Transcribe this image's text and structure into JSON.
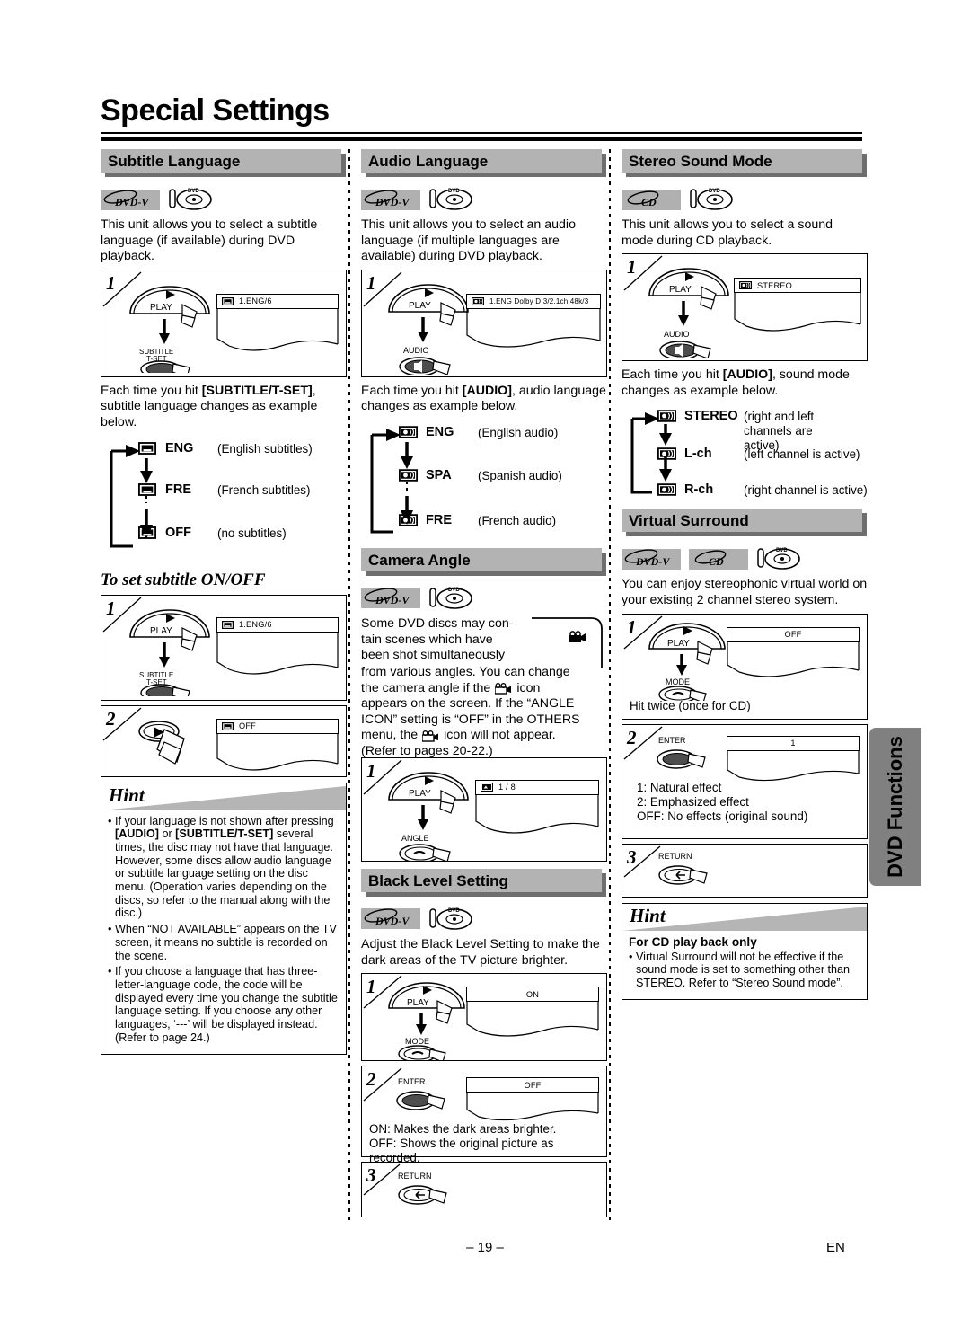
{
  "document": {
    "title": "Special Settings",
    "page_number": "– 19 –",
    "language_code": "EN",
    "side_tab": "DVD Functions"
  },
  "columns": {
    "left": {
      "subtitle_language": {
        "heading": "Subtitle Language",
        "badges": [
          "DVD-V",
          "disc-icon"
        ],
        "intro": "This unit allows you to select a subtitle language (if available) during DVD playback.",
        "step1": {
          "number": "1",
          "button_top": "PLAY",
          "button_bottom_line1": "SUBTITLE",
          "button_bottom_line2": "T-SET",
          "osd": "1.ENG/6",
          "osd_icon": "subtitle-icon"
        },
        "instruction_pre": "Each time you hit ",
        "instruction_key": "[SUBTITLE/T-SET]",
        "instruction_post": ", subtitle language changes as example below.",
        "cycle": [
          {
            "icon": "subtitle-icon",
            "code": "ENG",
            "desc": "(English subtitles)"
          },
          {
            "icon": "subtitle-icon",
            "code": "FRE",
            "desc": "(French subtitles)"
          },
          {
            "icon": "subtitle-icon",
            "code": "OFF",
            "desc": "(no subtitles)"
          }
        ],
        "onoff_heading": "To set subtitle ON/OFF",
        "onoff_step1": {
          "number": "1",
          "button_top": "PLAY",
          "button_bottom_line1": "SUBTITLE",
          "button_bottom_line2": "T-SET",
          "osd": "1.ENG/6"
        },
        "onoff_step2": {
          "number": "2",
          "osd": "OFF"
        }
      },
      "hint": {
        "title": "Hint",
        "items": [
          {
            "parts": [
              {
                "t": "If your language is not shown after pressing ",
                "b": false
              },
              {
                "t": "[AUDIO]",
                "b": true
              },
              {
                "t": " or ",
                "b": false
              },
              {
                "t": "[SUBTITLE/T-SET]",
                "b": true
              },
              {
                "t": " several times, the disc may not have that language. However, some discs allow audio language or subtitle language setting on the disc menu. (Operation varies depending on the discs, so refer to the manual along with the disc.)",
                "b": false
              }
            ]
          },
          {
            "parts": [
              {
                "t": "When “NOT AVAILABLE” appears on the TV screen, it means no subtitle is recorded on the scene.",
                "b": false
              }
            ]
          },
          {
            "parts": [
              {
                "t": "If you choose a language that has three-letter-language code, the code will be displayed every time you change the subtitle language setting. If you choose any other languages, ‘---’ will be displayed instead. (Refer to page 24.)",
                "b": false
              }
            ]
          }
        ]
      }
    },
    "middle": {
      "audio_language": {
        "heading": "Audio Language",
        "badges": [
          "DVD-V",
          "disc-icon"
        ],
        "intro": "This unit allows you to select an audio language (if multiple languages are available) during DVD playback.",
        "step1": {
          "number": "1",
          "button_top": "PLAY",
          "button_bottom_line1": "AUDIO",
          "osd": "1.ENG  Dolby D  3/2.1ch  48k/3",
          "osd_icon": "audio-icon"
        },
        "instruction_pre": "Each time you hit ",
        "instruction_key": "[AUDIO]",
        "instruction_post": ", audio language changes as example below.",
        "cycle": [
          {
            "icon": "audio-icon",
            "code": "ENG",
            "desc": "(English audio)"
          },
          {
            "icon": "audio-icon",
            "code": "SPA",
            "desc": "(Spanish audio)"
          },
          {
            "icon": "audio-icon",
            "code": "FRE",
            "desc": "(French audio)"
          }
        ]
      },
      "camera_angle": {
        "heading": "Camera Angle",
        "badges": [
          "DVD-V",
          "disc-icon"
        ],
        "body": "Some DVD discs may contain scenes which have been shot simultaneously from various angles. You can change the camera angle if the ▒ icon appears on the screen. If the “ANGLE ICON” setting is “OFF” in the OTHERS menu, the ▒ icon will not appear. (Refer to pages 20-22.)",
        "body_line1": "Some DVD discs may con-",
        "body_line2": "tain scenes which have",
        "body_line3": "been shot simultaneously",
        "body_line4": "from various angles. You can change",
        "body_line5a": "the camera angle if the",
        "body_line5b": "icon",
        "body_line6": "appears on the screen. If the “ANGLE",
        "body_line7": "ICON” setting is “OFF” in the OTHERS",
        "body_line8a": "menu, the",
        "body_line8b": "icon will not appear.",
        "body_line9": "(Refer to pages 20-22.)",
        "step1": {
          "number": "1",
          "button_top": "PLAY",
          "button_bottom_line1": "ANGLE",
          "osd": "1 / 8",
          "osd_icon": "angle-icon"
        }
      },
      "black_level": {
        "heading": "Black Level Setting",
        "badges": [
          "DVD-V",
          "disc-icon"
        ],
        "intro": "Adjust the Black Level Setting to make the dark areas of the TV picture brighter.",
        "step1": {
          "number": "1",
          "button_top": "PLAY",
          "button_bottom_line1": "MODE",
          "osd": "ON"
        },
        "step2": {
          "number": "2",
          "button_bottom_line1": "ENTER",
          "osd": "OFF",
          "note_line1": "ON: Makes the dark areas brighter.",
          "note_line2": "OFF: Shows the original picture as recorded."
        },
        "step3": {
          "number": "3",
          "button_bottom_line1": "RETURN"
        }
      }
    },
    "right": {
      "stereo_sound_mode": {
        "heading": "Stereo Sound Mode",
        "badges": [
          "CD",
          "disc-icon"
        ],
        "intro": "This unit allows you to select a sound mode during CD playback.",
        "step1": {
          "number": "1",
          "button_top": "PLAY",
          "button_bottom_line1": "AUDIO",
          "osd": "STEREO",
          "osd_icon": "audio-icon"
        },
        "instruction_pre": "Each time you hit ",
        "instruction_key": "[AUDIO]",
        "instruction_post": ", sound mode changes as example below.",
        "cycle": [
          {
            "icon": "audio-icon",
            "code": "STEREO",
            "desc": "(right and left channels are active)"
          },
          {
            "icon": "audio-icon",
            "code": "L-ch",
            "desc": "(left channel is active)"
          },
          {
            "icon": "audio-icon",
            "code": "R-ch",
            "desc": "(right channel is active)"
          }
        ]
      },
      "virtual_surround": {
        "heading": "Virtual Surround",
        "badges": [
          "DVD-V",
          "CD",
          "disc-icon"
        ],
        "intro": "You can enjoy stereophonic virtual world on your existing 2 channel stereo system.",
        "step1": {
          "number": "1",
          "button_top": "PLAY",
          "button_bottom_line1": "MODE",
          "osd": "OFF",
          "note": "Hit twice (once for CD)"
        },
        "step2": {
          "number": "2",
          "button_bottom_line1": "ENTER",
          "osd": "1",
          "note_line1": "1: Natural effect",
          "note_line2": "2: Emphasized effect",
          "note_line3": "OFF: No effects (original sound)"
        },
        "step3": {
          "number": "3",
          "button_bottom_line1": "RETURN"
        }
      },
      "hint": {
        "title": "Hint",
        "subtitle": "For CD play back only",
        "items": [
          {
            "parts": [
              {
                "t": "Virtual Surround will not be effective if the sound mode is set to something other than STEREO. Refer to “Stereo Sound mode”.",
                "b": false
              }
            ]
          }
        ]
      }
    }
  },
  "colors": {
    "header_bar": "#b3b3b3",
    "header_shadow": "#6e6e6e",
    "badge_bg": "#b0b0b0",
    "side_tab": "#808080",
    "text": "#000000"
  }
}
